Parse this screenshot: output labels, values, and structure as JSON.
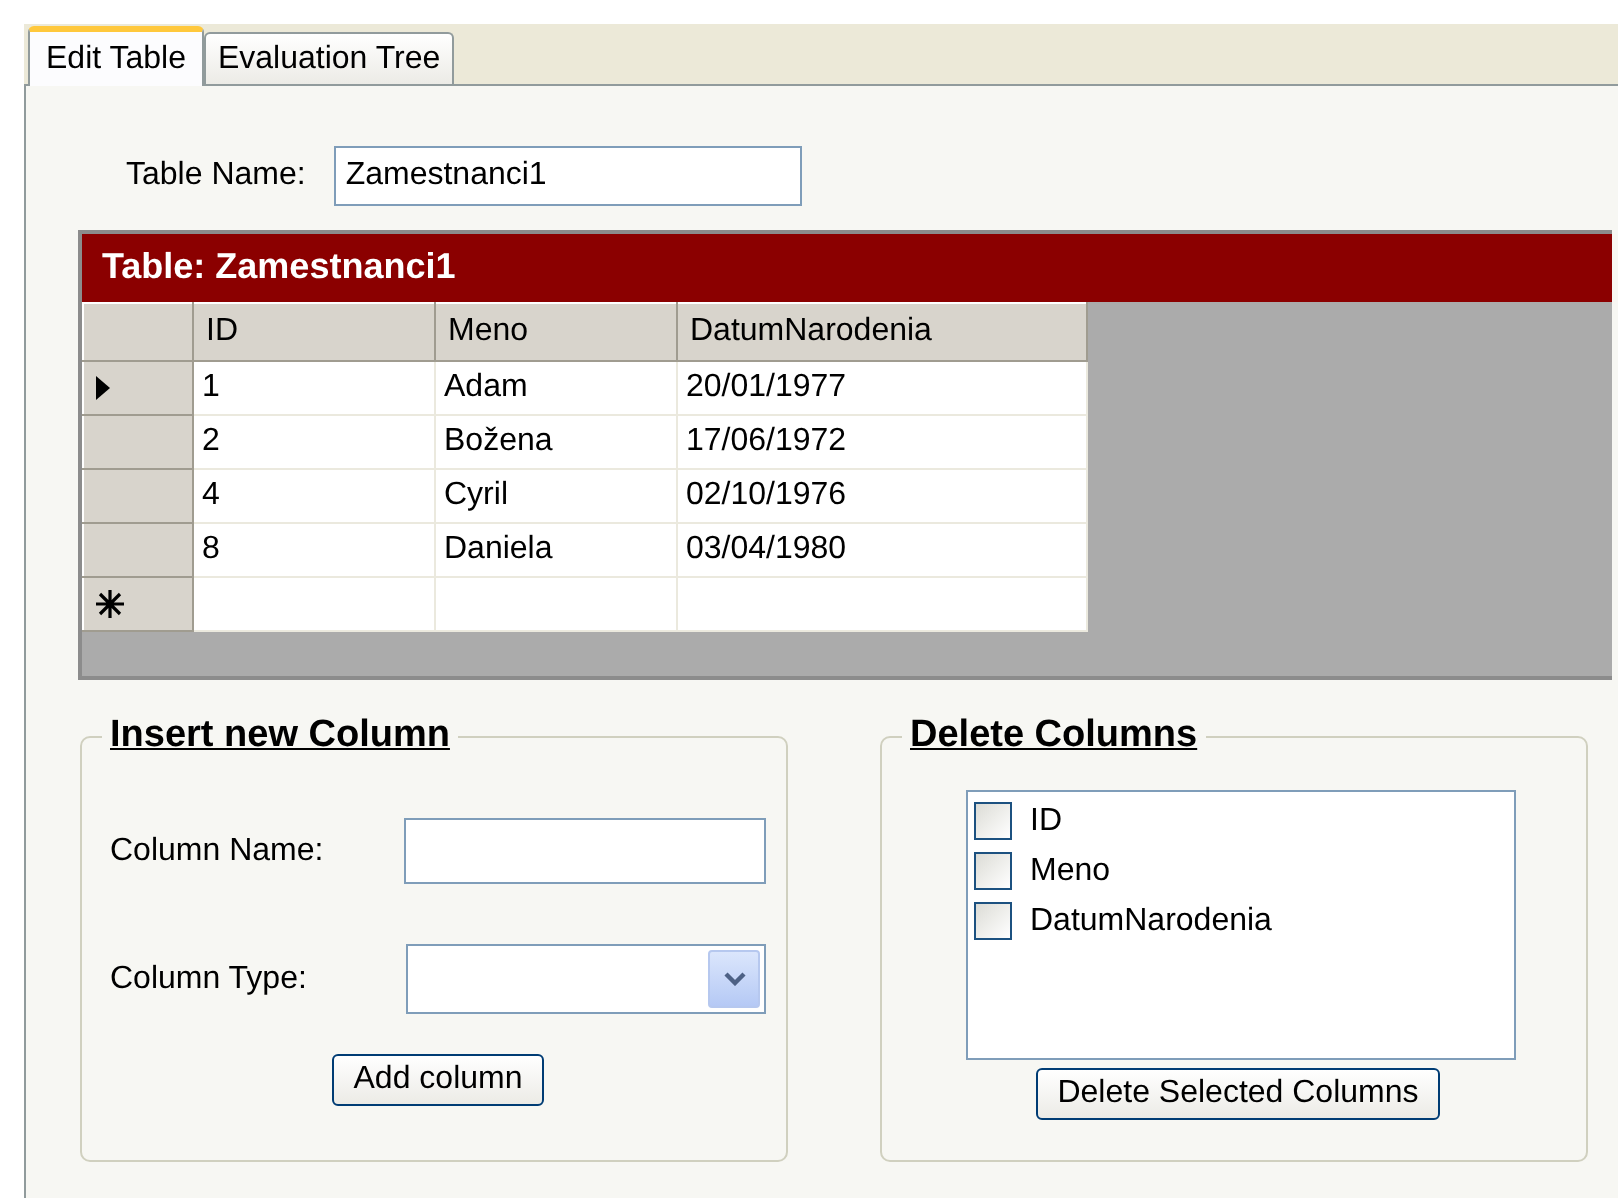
{
  "tabs": [
    {
      "label": "Edit Table",
      "selected": true
    },
    {
      "label": "Evaluation Tree",
      "selected": false
    }
  ],
  "table_name": {
    "label": "Table Name:",
    "value": "Zamestnanci1"
  },
  "grid": {
    "caption": "Table: Zamestnanci1",
    "columns": [
      "ID",
      "Meno",
      "DatumNarodenia"
    ],
    "rows": [
      {
        "cells": [
          "1",
          "Adam",
          "20/01/1977"
        ],
        "current": true
      },
      {
        "cells": [
          "2",
          "Božena",
          "17/06/1972"
        ],
        "current": false
      },
      {
        "cells": [
          "4",
          "Cyril",
          "02/10/1976"
        ],
        "current": false
      },
      {
        "cells": [
          "8",
          "Daniela",
          "03/04/1980"
        ],
        "current": false
      }
    ],
    "new_row": true
  },
  "insert_group": {
    "title": "Insert new Column",
    "column_name": {
      "label": "Column Name:"
    },
    "column_type": {
      "label": "Column Type:"
    },
    "button": "Add column"
  },
  "delete_group": {
    "title": "Delete Columns",
    "items": [
      {
        "label": "ID",
        "checked": false
      },
      {
        "label": "Meno",
        "checked": false
      },
      {
        "label": "DatumNarodenia",
        "checked": false
      }
    ],
    "button": "Delete Selected Columns"
  }
}
